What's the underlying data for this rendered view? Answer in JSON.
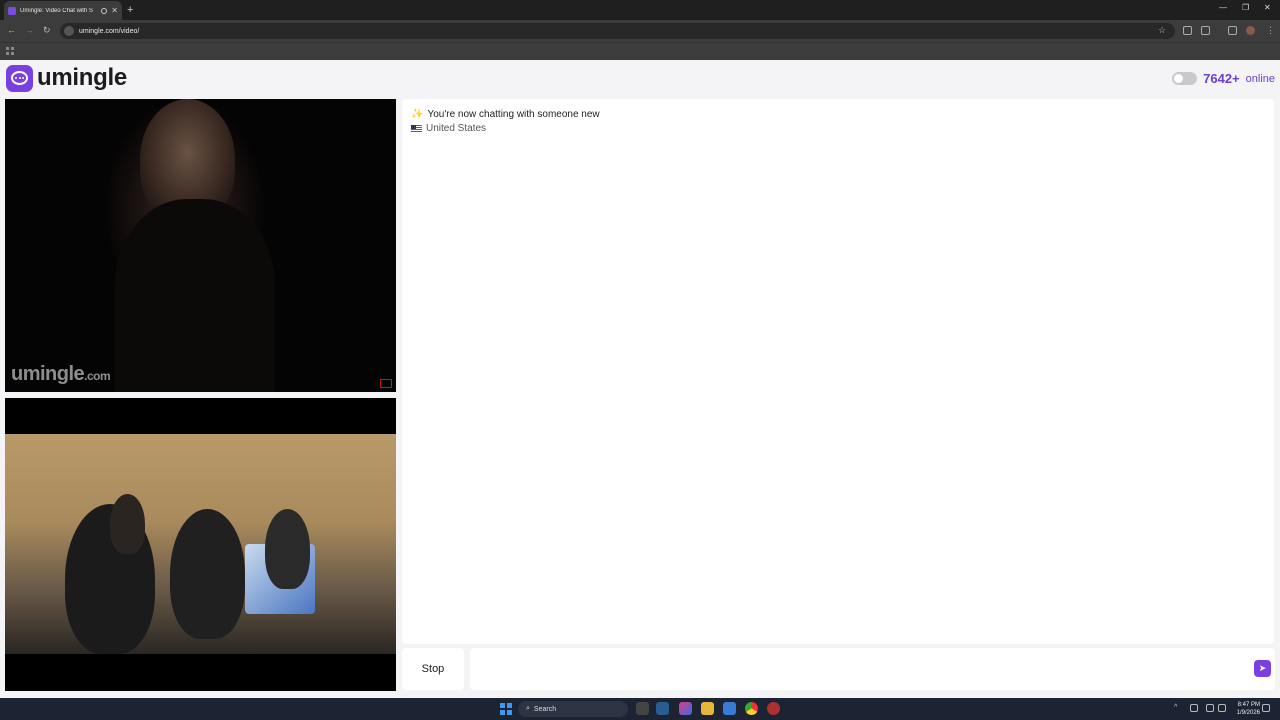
{
  "browser": {
    "tab_title": "Umingle: Video Chat with S",
    "url": "umingle.com/video/"
  },
  "site": {
    "logo_text": "umingle",
    "online_count": "7642+",
    "online_label": "online",
    "watermark_main": "umingle",
    "watermark_suffix": ".com"
  },
  "chat": {
    "system_message": "You're now chatting with someone new",
    "country": "United States"
  },
  "controls": {
    "stop_label": "Stop",
    "message_placeholder": ""
  },
  "taskbar": {
    "search_label": "Search",
    "time": "8:47 PM",
    "date": "1/9/2026"
  },
  "colors": {
    "brand": "#7a3fe0",
    "online_text": "#6b3fd4"
  }
}
